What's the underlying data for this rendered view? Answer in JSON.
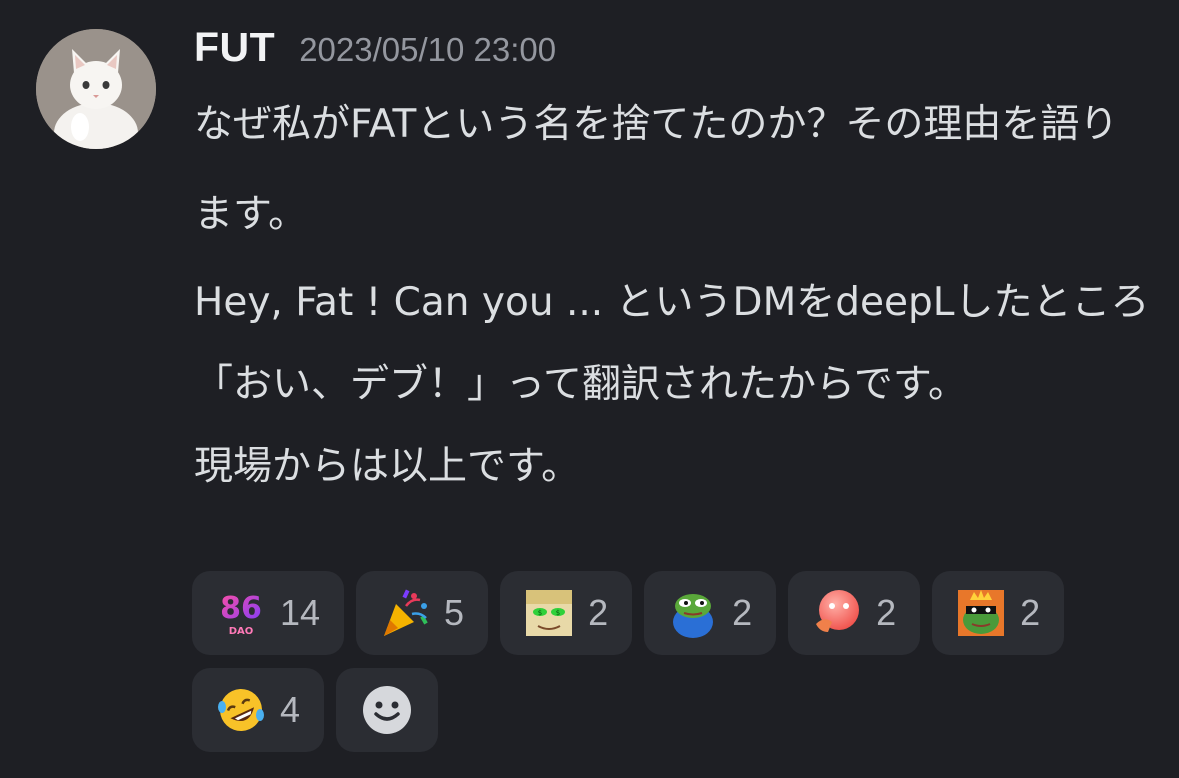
{
  "message": {
    "author": "FUT",
    "timestamp": "2023/05/10 23:00",
    "paragraphs": [
      "なぜ私がFATという名を捨てたのか？その理由を語ります。",
      "Hey, Fat ! Can you ... というDMをdeepLしたところ「おい、デブ！」って翻訳されたからです。",
      "現場からは以上です。"
    ]
  },
  "reactions": [
    {
      "emoji": "86dao-icon",
      "count": "14"
    },
    {
      "emoji": "party-popper-icon",
      "count": "5"
    },
    {
      "emoji": "money-eyes-meme-icon",
      "count": "2"
    },
    {
      "emoji": "pepe-blue-icon",
      "count": "2"
    },
    {
      "emoji": "blushing-thinking-icon",
      "count": "2"
    },
    {
      "emoji": "pepe-king-icon",
      "count": "2"
    },
    {
      "emoji": "rofl-icon",
      "count": "4"
    }
  ],
  "add_reaction": {
    "icon": "smiley-add-reaction-icon"
  },
  "colors": {
    "background": "#1e1f24",
    "reaction_bg": "#2b2d33",
    "username": "#f2f3f5",
    "timestamp": "#94979f",
    "text": "#dbdee1"
  }
}
